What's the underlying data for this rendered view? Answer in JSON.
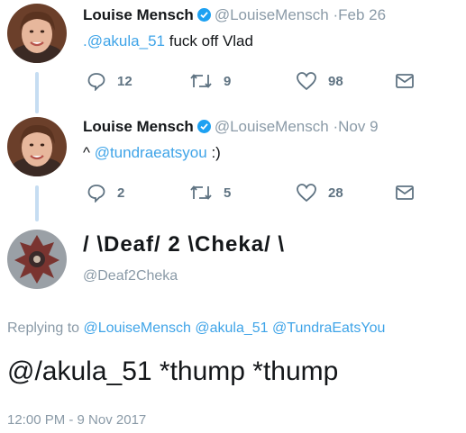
{
  "tweet1": {
    "name": "Louise Mensch",
    "handle": "@LouiseMensch",
    "sep": "·",
    "date": "Feb 26",
    "mention": ".@akula_51",
    "text": " fuck off Vlad",
    "replies": "12",
    "retweets": "9",
    "likes": "98"
  },
  "tweet2": {
    "name": "Louise Mensch",
    "handle": "@LouiseMensch",
    "sep": "·",
    "date": "Nov 9",
    "prefix": "^ ",
    "mention": "@tundraeatsyou",
    "text": " :)",
    "replies": "2",
    "retweets": "5",
    "likes": "28"
  },
  "tweet3": {
    "display_name": "/ \\Deaf/ 2 \\Cheka/ \\",
    "handle": "@Deaf2Cheka",
    "replying_label": "Replying to ",
    "replying_to": [
      "@LouiseMensch",
      "@akula_51",
      "@TundraEatsYou"
    ],
    "text": "@/akula_51 *thump *thump",
    "timestamp": "12:00 PM - 9 Nov 2017"
  },
  "icons": {
    "reply": "reply-icon",
    "retweet": "retweet-icon",
    "like": "heart-icon",
    "message": "envelope-icon",
    "verified": "verified-badge-icon"
  },
  "colors": {
    "link": "#3fa4e8",
    "verified": "#1da1f2",
    "muted": "#8a9aa7",
    "thread_line": "#c6ddf2"
  }
}
